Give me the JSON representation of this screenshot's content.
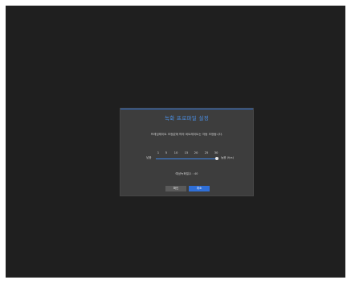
{
  "dialog": {
    "title": "녹화 프로파일 설정",
    "description": "프레임레이트 조정값에 따라 비트레이트는 자동 조정됩니다.",
    "slider": {
      "ticks": [
        "1",
        "5",
        "10",
        "15",
        "20",
        "25",
        "30"
      ],
      "low_label": "낮음",
      "high_label": "높음 (fps)",
      "value_fraction": 0.95
    },
    "expected": "예상녹화일수 : 40",
    "ok_label": "확인",
    "cancel_label": "취소"
  },
  "colors": {
    "accent": "#3f86e6",
    "background": "#1f1f1f",
    "dialog": "#3d3d3d"
  }
}
